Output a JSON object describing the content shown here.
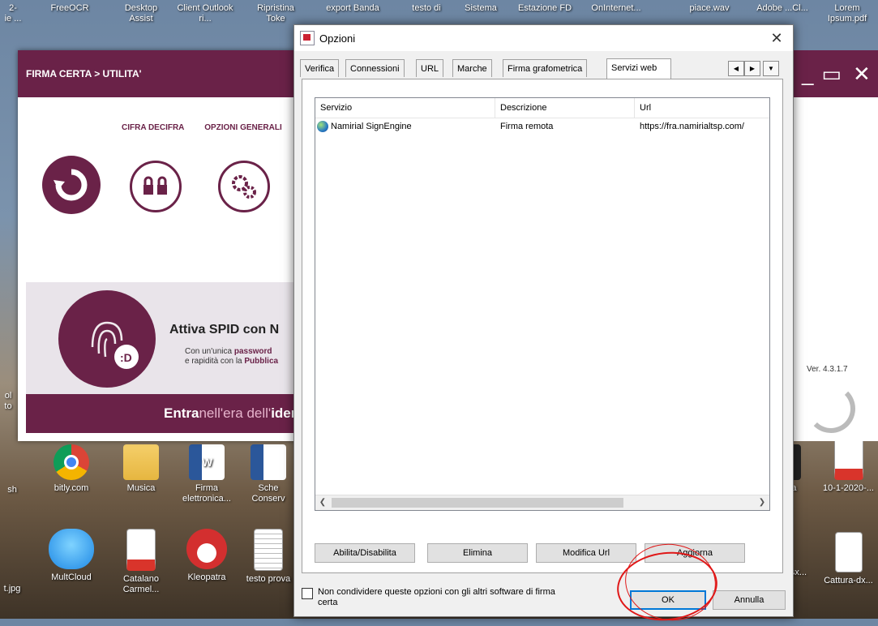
{
  "desktop_top": [
    "FreeOCR",
    "Desktop Assist",
    "Client Outlook ri...",
    "Ripristina Toke",
    "export Banda",
    "testo di",
    "Sistema",
    "Estazione FD",
    "OnInternet...",
    "piace.wav",
    "Adobe ...Cl...",
    "Lorem Ipsum.pdf"
  ],
  "desktop_left_partial": [
    "2-",
    "ie ...",
    "sh",
    "t.jpg",
    "ol",
    "to"
  ],
  "desktop_icons": [
    {
      "label": "bitly.com",
      "icon": "chrome-icon"
    },
    {
      "label": "Musica",
      "icon": "folder-icon"
    },
    {
      "label": "Firma elettronica...",
      "icon": "word-doc-icon"
    },
    {
      "label": "Sche Conserv",
      "icon": "word-doc-icon"
    },
    {
      "label": "MultCloud",
      "icon": "cloud-icon"
    },
    {
      "label": "Catalano Carmel...",
      "icon": "pdf-icon"
    },
    {
      "label": "Kleopatra",
      "icon": "kleopatra-icon"
    },
    {
      "label": "testo prova",
      "icon": "text-file-icon"
    },
    {
      "label": "erta",
      "icon": "app-icon"
    },
    {
      "label": "10-1-2020-...",
      "icon": "pdf-icon"
    },
    {
      "label": "sx...",
      "icon": "file-icon"
    },
    {
      "label": "Cattura-dx...",
      "icon": "image-icon"
    }
  ],
  "bg_app": {
    "title": "FIRMA CERTA > UTILITA'",
    "nav": [
      "CIFRA DECIFRA",
      "OPZIONI GENERALI"
    ],
    "banner_title": "Attiva SPID con N",
    "banner_line1_plain": "Con un'unica ",
    "banner_line1_bold": "password",
    "banner_line2_plain": "e rapidità con la ",
    "banner_line2_bold": "Pubblica",
    "banner_foot_bold": "Entra",
    "banner_foot_plain": " nell'era dell'",
    "banner_foot_tail": "ider",
    "version": "Ver. 4.3.1.7"
  },
  "dialog": {
    "title": "Opzioni",
    "tabs": [
      "Verifica",
      "Connessioni",
      "URL",
      "Marche",
      "Firma grafometrica",
      "Servizi web"
    ],
    "active_tab": "Servizi web",
    "columns": [
      "Servizio",
      "Descrizione",
      "Url"
    ],
    "rows": [
      {
        "servizio": "Namirial SignEngine",
        "descrizione": "Firma remota",
        "url": "https://fra.namirialtsp.com/"
      }
    ],
    "buttons": {
      "toggle": "Abilita/Disabilita",
      "delete": "Elimina",
      "edit_url": "Modifica Url",
      "refresh": "Aggiorna",
      "ok": "OK",
      "cancel": "Annulla"
    },
    "checkbox_label": "Non condividere queste opzioni con gli altri software di firma certa"
  }
}
